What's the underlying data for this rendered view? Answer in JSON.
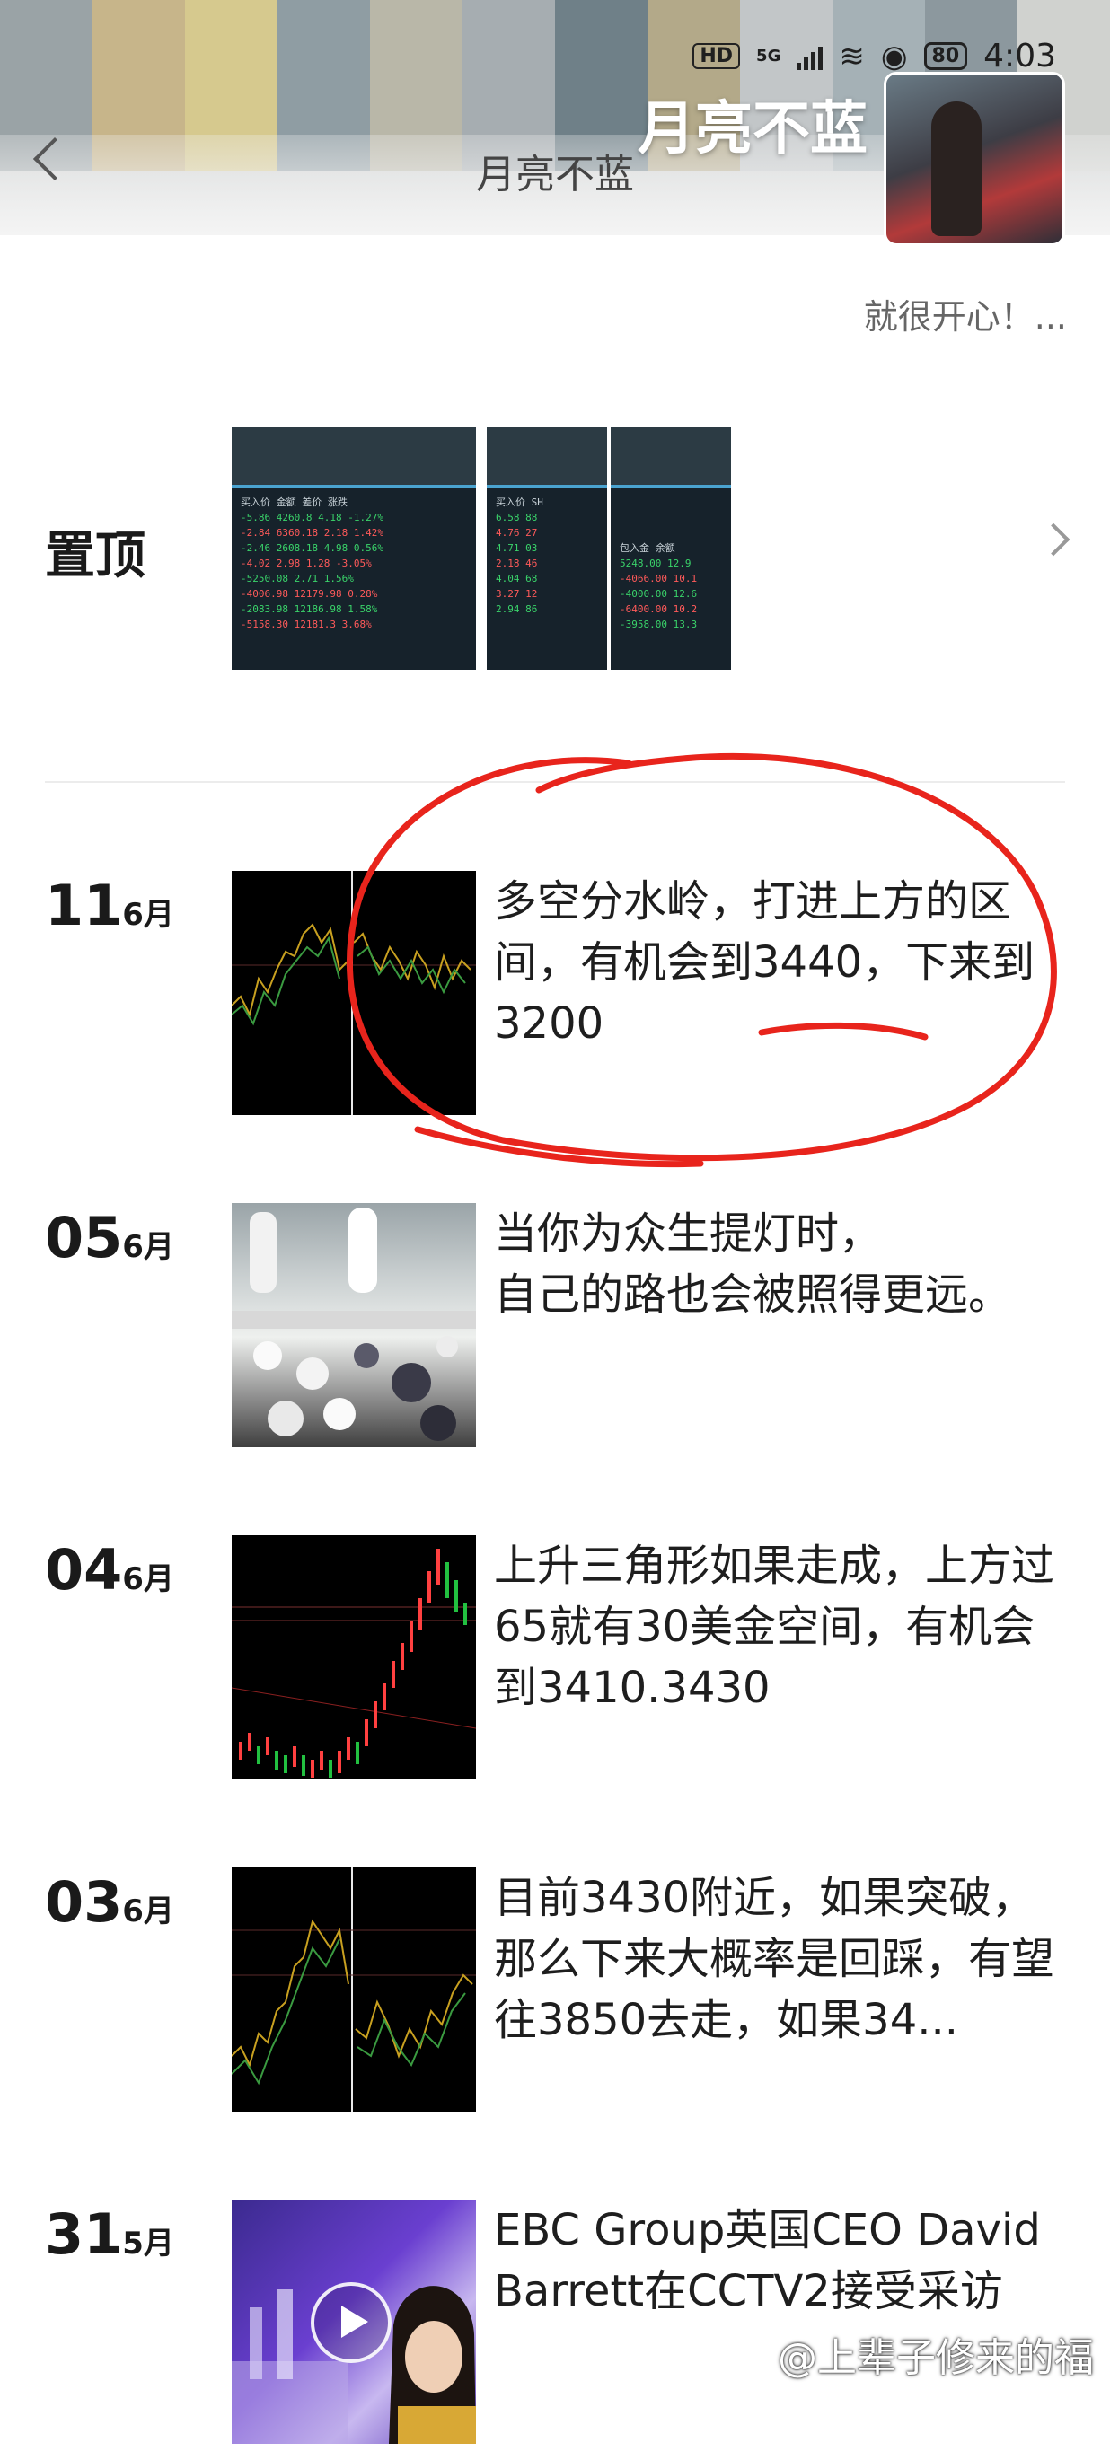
{
  "status_bar": {
    "hd": "HD",
    "network": "5G",
    "battery": "80",
    "time": "4:03"
  },
  "nav": {
    "title": "月亮不蓝"
  },
  "profile": {
    "name": "月亮不蓝",
    "signature": "就很开心！..."
  },
  "pinned": {
    "label": "置顶"
  },
  "posts": [
    {
      "day": "11",
      "month": "6月",
      "text": "多空分水岭，打进上方的区间，有机会到3440，下来到3200"
    },
    {
      "day": "05",
      "month": "6月",
      "text": "当你为众生提灯时，\n自己的路也会被照得更远。"
    },
    {
      "day": "04",
      "month": "6月",
      "text": "上升三角形如果走成，上方过65就有30美金空间，有机会到3410.3430"
    },
    {
      "day": "03",
      "month": "6月",
      "text": "目前3430附近，如果突破，那么下来大概率是回踩，有望往3850去走，如果34..."
    },
    {
      "day": "31",
      "month": "5月",
      "text": "EBC Group英国CEO David Barrett在CCTV2接受采访"
    }
  ],
  "watermark": "@上辈子修来的福",
  "colors": {
    "annotation": "#e8241c",
    "accent_green": "#3ad36a",
    "accent_red": "#ff5a5a"
  }
}
